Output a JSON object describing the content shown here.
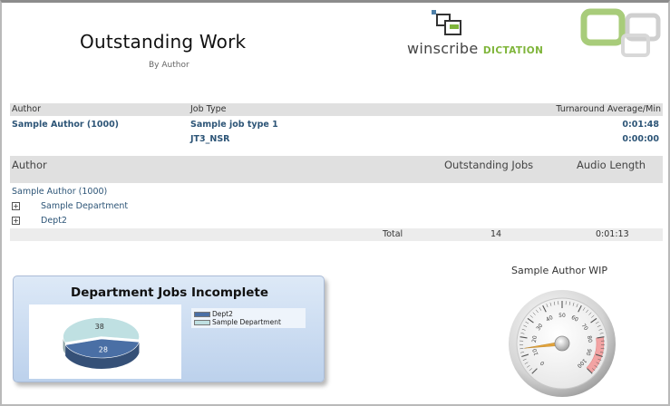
{
  "report": {
    "title": "Outstanding Work",
    "subtitle": "By Author",
    "logo": {
      "text": "winscribe",
      "highlight": "DICTATION"
    }
  },
  "turnaround_table": {
    "columns": [
      "Author",
      "Job Type",
      "Turnaround Average/Min"
    ],
    "rows": [
      {
        "author": "Sample Author (1000)",
        "job_type": "Sample job type 1",
        "turnaround": "0:01:48"
      },
      {
        "author": "",
        "job_type": "JT3_NSR",
        "turnaround": "0:00:00"
      }
    ]
  },
  "outstanding_table": {
    "columns": [
      "Author",
      "Outstanding Jobs",
      "Audio Length"
    ],
    "author": "Sample Author (1000)",
    "groups": [
      {
        "expand": "+",
        "label": "Sample Department"
      },
      {
        "expand": "+",
        "label": "Dept2"
      }
    ],
    "total": {
      "label": "Total",
      "jobs": "14",
      "audio": "0:01:13"
    }
  },
  "pie_panel": {
    "title": "Department Jobs Incomplete",
    "legend": [
      {
        "label": "Dept2",
        "color": "#4a6fa5"
      },
      {
        "label": "Sample Department",
        "color": "#bfe0e2"
      }
    ],
    "chart_data": {
      "type": "pie",
      "labels": [
        "Dept2",
        "Sample Department"
      ],
      "values": [
        28,
        38
      ],
      "colors": [
        "#4a6fa5",
        "#bfe0e2"
      ]
    }
  },
  "gauge": {
    "title": "Sample Author WIP",
    "ticks": [
      "0",
      "10",
      "20",
      "30",
      "40",
      "50",
      "60",
      "70",
      "80",
      "90",
      "100"
    ],
    "needle_value": 14
  }
}
